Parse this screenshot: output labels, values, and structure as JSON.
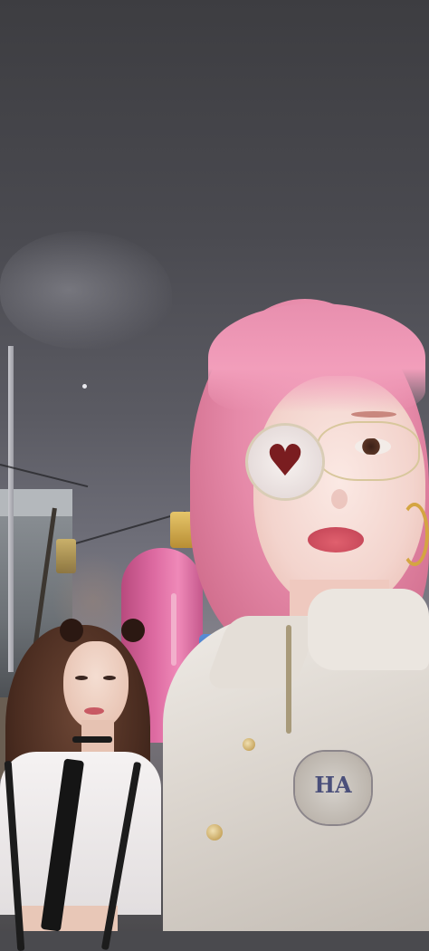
{
  "image": {
    "kind": "photo",
    "subjects": [
      "girl-with-pink-hair",
      "girl-with-brown-hair"
    ],
    "emblem_text": "HA"
  },
  "colors": {
    "sky": "#4a4a50",
    "pink_hair": "#e68aa9",
    "jacket": "#dcd6cf",
    "heart": "#7a1d20",
    "tower": "#dd6aa1"
  }
}
